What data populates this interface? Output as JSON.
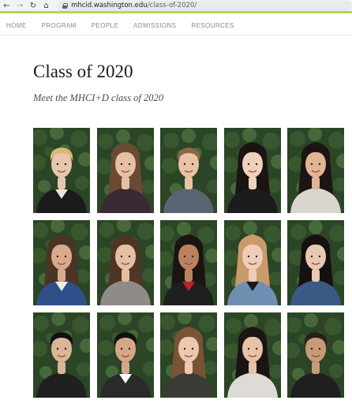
{
  "browser": {
    "url_host": "mhcid.washington.edu",
    "url_path": "/class-of-2020/"
  },
  "nav": {
    "items": [
      "HOME",
      "PROGRAM",
      "PEOPLE",
      "ADMISSIONS",
      "RESOURCES"
    ]
  },
  "page": {
    "title": "Class of 2020",
    "subtitle": "Meet the MHCI+D class of 2020"
  },
  "portraits": [
    {
      "skin": "#e8c6ad",
      "hair": "#d9b77a",
      "style": "short",
      "shirt": "#1b1b1b",
      "collar": "#ece6dc"
    },
    {
      "skin": "#e6c0a4",
      "hair": "#6a4a33",
      "style": "long",
      "shirt": "#3a2a33",
      "collar": ""
    },
    {
      "skin": "#e9c3a6",
      "hair": "#8a6a45",
      "style": "short",
      "shirt": "#5a6472",
      "collar": ""
    },
    {
      "skin": "#efd2bc",
      "hair": "#1a1412",
      "style": "long",
      "shirt": "#1c1c1c",
      "collar": ""
    },
    {
      "skin": "#e0b596",
      "hair": "#1b1513",
      "style": "long",
      "shirt": "#d9d6d0",
      "collar": ""
    },
    {
      "skin": "#d9a98c",
      "hair": "#4a3424",
      "style": "long",
      "shirt": "#2f4f8a",
      "collar": "#f0ece4"
    },
    {
      "skin": "#e4bfa2",
      "hair": "#4e3626",
      "style": "long",
      "shirt": "#8f8c88",
      "collar": ""
    },
    {
      "skin": "#b98360",
      "hair": "#1a1412",
      "style": "long",
      "shirt": "#1f1f1f",
      "collar": "#c0222e"
    },
    {
      "skin": "#f0cdb8",
      "hair": "#c99a6a",
      "style": "long",
      "shirt": "#6f8fb2",
      "collar": "#1a1a1a"
    },
    {
      "skin": "#e8c8b2",
      "hair": "#16110f",
      "style": "long",
      "shirt": "#3a5a86",
      "collar": ""
    },
    {
      "skin": "#dcb597",
      "hair": "#111111",
      "style": "short",
      "shirt": "#202020",
      "collar": ""
    },
    {
      "skin": "#d4a887",
      "hair": "#111111",
      "style": "short",
      "shirt": "#2a2a2a",
      "collar": "#ffffff"
    },
    {
      "skin": "#edc8b0",
      "hair": "#7a5234",
      "style": "long",
      "shirt": "#3a3a36",
      "collar": ""
    },
    {
      "skin": "#e6c2a6",
      "hair": "#1a1412",
      "style": "long",
      "shirt": "#dedbd6",
      "collar": ""
    },
    {
      "skin": "#c99a7a",
      "hair": "#2a1e18",
      "style": "short",
      "shirt": "#1f1f1f",
      "collar": ""
    }
  ],
  "colors": {
    "accent_bar": "#b5d94a",
    "foliage_dark": "#2b4526",
    "foliage_light": "#4c6e3c"
  }
}
